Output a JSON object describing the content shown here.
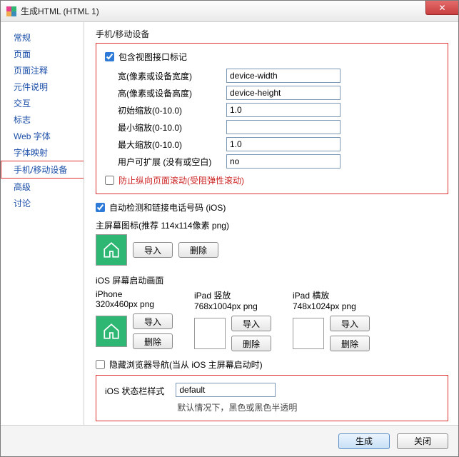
{
  "window": {
    "title": "生成HTML (HTML 1)",
    "close_glyph": "✕"
  },
  "sidebar": {
    "items": [
      {
        "label": "常规"
      },
      {
        "label": "页面"
      },
      {
        "label": "页面注释"
      },
      {
        "label": "元件说明"
      },
      {
        "label": "交互"
      },
      {
        "label": "标志"
      },
      {
        "label": "Web 字体"
      },
      {
        "label": "字体映射"
      },
      {
        "label": "手机/移动设备"
      },
      {
        "label": "高级"
      },
      {
        "label": "讨论"
      }
    ],
    "selected_index": 8
  },
  "content": {
    "section_title": "手机/移动设备",
    "viewport": {
      "include_tag_label": "包含视图接口标记",
      "include_tag_checked": true,
      "rows": [
        {
          "label": "宽(像素或设备宽度)",
          "value": "device-width"
        },
        {
          "label": "高(像素或设备高度)",
          "value": "device-height"
        },
        {
          "label": "初始缩放(0-10.0)",
          "value": "1.0"
        },
        {
          "label": "最小缩放(0-10.0)",
          "value": ""
        },
        {
          "label": "最大缩放(0-10.0)",
          "value": "1.0"
        },
        {
          "label": "用户可扩展 (没有或空白)",
          "value": "no"
        }
      ],
      "prevent_scroll_label": "防止纵向页面滚动(受阻弹性滚动)",
      "prevent_scroll_checked": false
    },
    "auto_detect_phone_label": "自动检测和链接电话号码 (iOS)",
    "auto_detect_phone_checked": true,
    "home_icon_label": "主屏幕图标(推荐 114x114像素 png)",
    "import_label": "导入",
    "delete_label": "删除",
    "splash": {
      "title": "iOS 屏幕启动画面",
      "cols": [
        {
          "name": "iPhone",
          "dim": "320x460px png",
          "has_image": true
        },
        {
          "name": "iPad 竖放",
          "dim": "768x1004px png",
          "has_image": false
        },
        {
          "name": "iPad 横放",
          "dim": "748x1024px png",
          "has_image": false
        }
      ]
    },
    "hide_nav_label": "隐藏浏览器导航(当从 iOS 主屏幕启动时)",
    "hide_nav_checked": false,
    "statusbar": {
      "label": "iOS 状态栏样式",
      "value": "default",
      "hint": "默认情况下，黑色或黑色半透明"
    }
  },
  "footer": {
    "generate": "生成",
    "close": "关闭"
  }
}
